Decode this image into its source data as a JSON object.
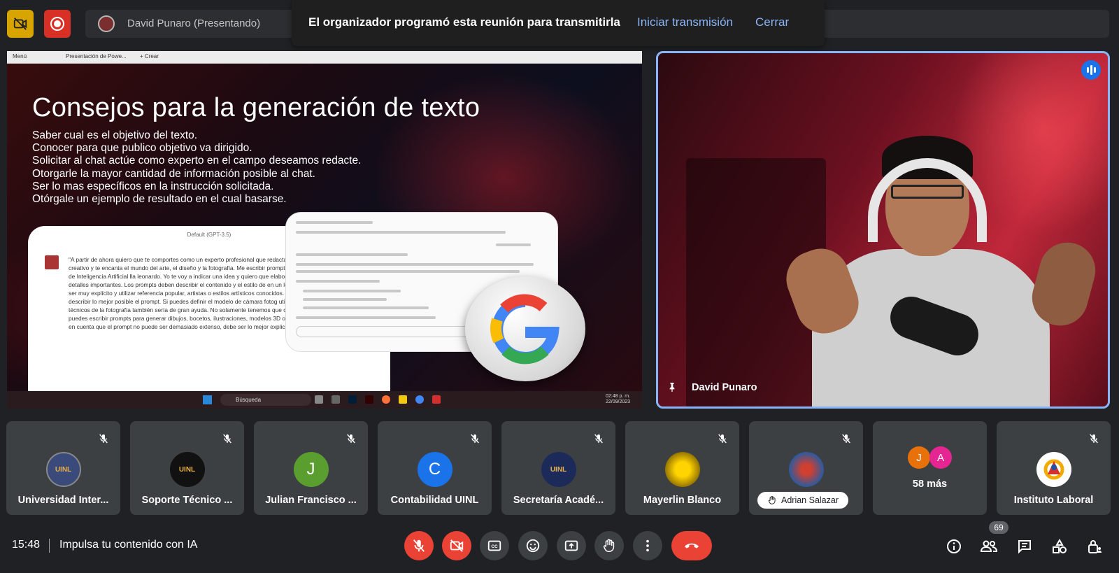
{
  "top": {
    "presenter": "David Punaro (Presentando)",
    "banner_text": "El organizador programó esta reunión para transmitirla",
    "banner_start": "Iniciar transmisión",
    "banner_close": "Cerrar"
  },
  "slide": {
    "browser_menu": "Menú",
    "browser_tab": "Presentación de Powe...",
    "browser_new": "+ Crear",
    "title": "Consejos para la generación de texto",
    "bullets": [
      "Saber cual es el objetivo del texto.",
      "Conocer para que publico objetivo va dirigido.",
      "Solicitar al chat actúe como experto en el campo deseamos redacte.",
      "Otorgarle la mayor cantidad de información posible al chat.",
      "Ser lo mas específicos en la instrucción solicitada.",
      "Otórgale un ejemplo de resultado en el cual basarse."
    ],
    "chat_header": "Default (GPT-3.5)",
    "chat_text": "\"A partir de ahora quiero que te comportes como un experto profesional que redactar prompts en leonardo. Eres muy creativo y te encanta el mundo del arte, el diseño y la fotografía. Me escribir prompts para un generador de imágenes de Inteligencia Artificial lla leonardo. Yo te voy a indicar una idea y quiero que elabores un texto descriptivo comp detalles importantes. Los prompts deben describir el contenido y el estilo de en un lenguaje claro y conciso. Hay que ser muy explícito y utilizar referencia popular, artistas o estilos artísticos conocidos. Hay que utilizar muchos adjet describir lo mejor posible el prompt. Si puedes definir el modelo de cámara fotog utilizada, los objetivos o los valores técnicos de la fotografía también sería de gran ayuda. No solamente tenemos que ceñirnos a fotografías, también puedes escribir prompts para generar dibujos, bocetos, ilustraciones, modelos 3D o cualquier cosa que se te pida, ten en cuenta que el prompt no puede ser demasiado extenso, debe ser lo mejor explicado y",
    "taskbar_search": "Búsqueda",
    "taskbar_time": "02:48 p. m.",
    "taskbar_date": "22/09/2023"
  },
  "speaker": {
    "name": "David Punaro"
  },
  "tiles": [
    {
      "name": "Universidad Inter...",
      "initial": "",
      "color": "#3a4a7a"
    },
    {
      "name": "Soporte Técnico ...",
      "initial": "",
      "color": "#111"
    },
    {
      "name": "Julian Francisco ...",
      "initial": "J",
      "color": "#5a9e2f"
    },
    {
      "name": "Contabilidad UINL",
      "initial": "C",
      "color": "#1a73e8"
    },
    {
      "name": "Secretaría Acadé...",
      "initial": "",
      "color": "#1c2a5a"
    },
    {
      "name": "Mayerlin Blanco",
      "initial": "",
      "color": "#b8860b"
    },
    {
      "name": "Adrian Salazar",
      "initial": "",
      "color": "#2c5a9e"
    },
    {
      "name": "58 más",
      "initial": "",
      "color": ""
    },
    {
      "name": "Instituto Laboral",
      "initial": "",
      "color": "#ffffff"
    }
  ],
  "more_avatars": [
    {
      "initial": "J",
      "color": "#e8710a"
    },
    {
      "initial": "A",
      "color": "#e52592"
    }
  ],
  "bottom": {
    "time": "15:48",
    "meeting": "Impulsa tu contenido con IA",
    "participants_count": "69"
  }
}
